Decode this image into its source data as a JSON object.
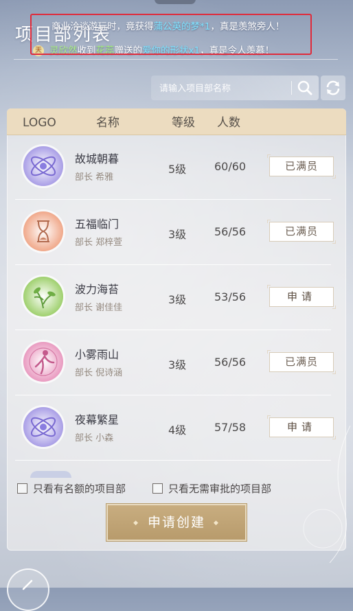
{
  "page": {
    "title": "项目部列表"
  },
  "broadcast": {
    "line1": {
      "pre": "商业洽谈游玩时，竟获得",
      "item": "蒲公英的梦*1",
      "post": "，真是羡煞旁人！"
    },
    "line2": {
      "avatar": "天",
      "name": "灵欣然",
      "mid1": "收到",
      "giver": "花蕊",
      "mid2": "赠送的",
      "item": "爱你的形状x1",
      "post": "，真是令人羡慕！"
    }
  },
  "search": {
    "placeholder": "请输入项目部名称"
  },
  "table": {
    "headers": {
      "logo": "LOGO",
      "name": "名称",
      "level": "等级",
      "count": "人数"
    },
    "rows": [
      {
        "name": "故城朝暮",
        "head": "部长 希雅",
        "level": "5级",
        "count": "60/60",
        "action": "已满员",
        "logo_icon": "atom-planet-icon"
      },
      {
        "name": "五福临门",
        "head": "部长 郑梓萱",
        "level": "3级",
        "count": "56/56",
        "action": "已满员",
        "logo_icon": "hourglass-icon"
      },
      {
        "name": "波力海苔",
        "head": "部长 谢佳佳",
        "level": "3级",
        "count": "53/56",
        "action": "申请",
        "logo_icon": "leaf-sprout-icon"
      },
      {
        "name": "小雾雨山",
        "head": "部长 倪诗涵",
        "level": "3级",
        "count": "56/56",
        "action": "已满员",
        "logo_icon": "dancer-icon"
      },
      {
        "name": "夜幕繁星",
        "head": "部长 小森",
        "level": "4级",
        "count": "57/58",
        "action": "申请",
        "logo_icon": "atom-planet-icon"
      }
    ]
  },
  "filters": {
    "has_quota": "只看有名额的项目部",
    "no_approval": "只看无需审批的项目部"
  },
  "create_button": "申请创建",
  "colors": {
    "accent_gold": "#bfa473",
    "header_beige": "#ecdcc0",
    "highlight_red": "#e02a3a"
  }
}
